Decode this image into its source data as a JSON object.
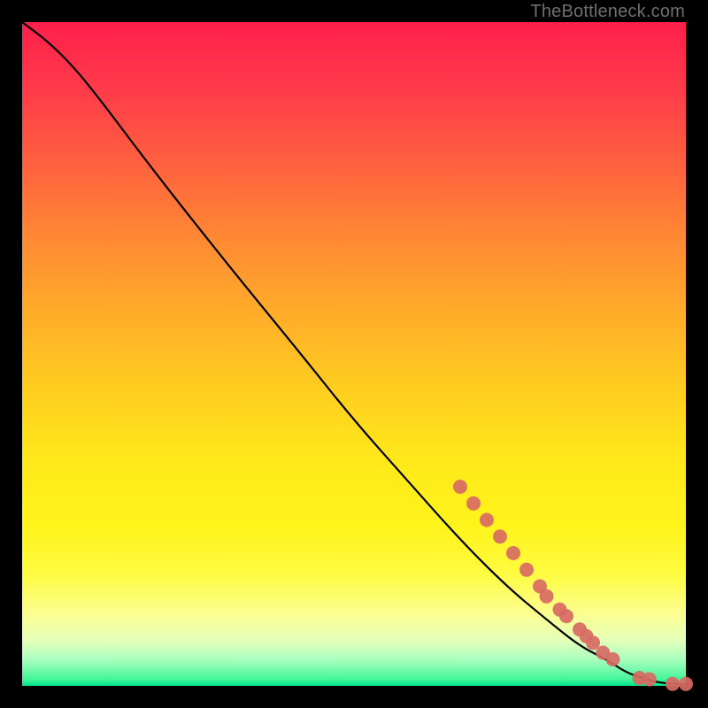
{
  "watermark": "TheBottleneck.com",
  "colors": {
    "background": "#000000",
    "curve": "#000000",
    "marker": "#d86a63",
    "gradient_top": "#ff1f4b",
    "gradient_mid": "#ffe81a",
    "gradient_bottom": "#00e38c"
  },
  "chart_data": {
    "type": "line",
    "title": "",
    "xlabel": "",
    "ylabel": "",
    "xlim": [
      0,
      100
    ],
    "ylim": [
      0,
      100
    ],
    "grid": false,
    "legend": false,
    "series": [
      {
        "name": "curve",
        "x": [
          0,
          4,
          8,
          12,
          18,
          25,
          33,
          42,
          50,
          58,
          66,
          73,
          79,
          84,
          88,
          91,
          94,
          96,
          98,
          100
        ],
        "y": [
          100,
          97,
          93,
          88,
          80,
          71,
          61,
          50,
          40,
          31,
          22,
          15,
          10,
          6,
          4,
          2,
          1,
          0.5,
          0.3,
          0.2
        ]
      }
    ],
    "markers": {
      "name": "highlighted-points",
      "x": [
        66,
        68,
        70,
        72,
        74,
        76,
        78,
        79,
        81,
        82,
        84,
        85,
        86,
        87.5,
        89,
        93,
        94.5,
        98,
        100
      ],
      "y": [
        30,
        27.5,
        25,
        22.5,
        20,
        17.5,
        15,
        13.5,
        11.5,
        10.5,
        8.5,
        7.5,
        6.5,
        5,
        4,
        1.2,
        1.0,
        0.3,
        0.3
      ]
    }
  }
}
